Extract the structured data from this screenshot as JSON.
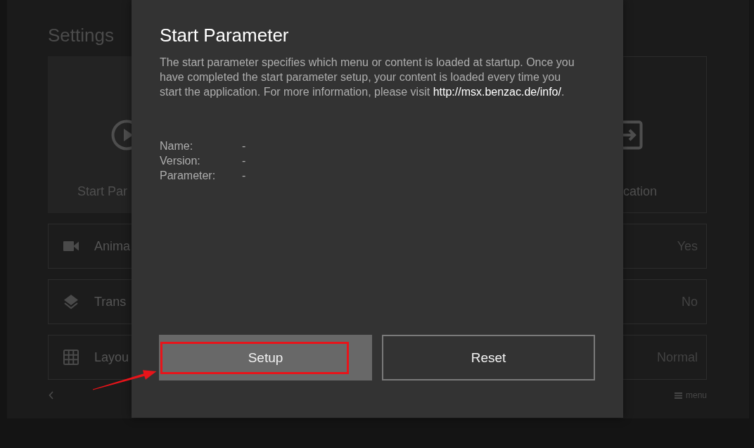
{
  "background": {
    "title": "Settings",
    "tiles": [
      {
        "label": "Start Par",
        "kind": "play",
        "focused": true
      },
      {
        "label": "cation",
        "kind": "exit",
        "focused": false
      }
    ],
    "rows": [
      {
        "label": "Anima",
        "value": "Yes",
        "kind": "camera"
      },
      {
        "label": "Trans",
        "value": "No",
        "kind": "layers"
      },
      {
        "label": "Layou",
        "value": "Normal",
        "kind": "grid"
      }
    ],
    "footer": {
      "menu_label": "menu"
    }
  },
  "dialog": {
    "title": "Start Parameter",
    "description": {
      "text": "The start parameter specifies which menu or content is loaded at startup. Once you have completed the start parameter setup, your content is loaded every time you start the application. For more information, please visit",
      "link": "http://msx.benzac.de/info/",
      "after": "."
    },
    "info": [
      {
        "label": "Name:",
        "value": "-"
      },
      {
        "label": "Version:",
        "value": "-"
      },
      {
        "label": "Parameter:",
        "value": "-"
      }
    ],
    "buttons": [
      {
        "label": "Setup",
        "focused": true,
        "annotated": true
      },
      {
        "label": "Reset",
        "focused": false,
        "annotated": false
      }
    ]
  }
}
